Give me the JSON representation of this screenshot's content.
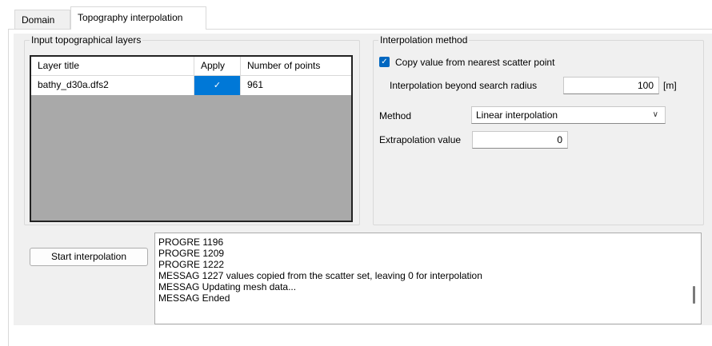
{
  "tabs": [
    {
      "label": "Domain"
    },
    {
      "label": "Topography interpolation"
    }
  ],
  "input_layers": {
    "title": "Input topographical layers",
    "columns": [
      "Layer title",
      "Apply",
      "Number of points"
    ],
    "rows": [
      {
        "layer_title": "bathy_d30a.dfs2",
        "apply": "✓",
        "number_of_points": "961"
      }
    ]
  },
  "interpolation": {
    "title": "Interpolation method",
    "copy_checkbox_label": "Copy value from nearest scatter point",
    "copy_checked": "✓",
    "beyond_radius_label": "Interpolation beyond search radius",
    "beyond_radius_value": "100",
    "beyond_radius_unit": "[m]",
    "method_label": "Method",
    "method_value": "Linear interpolation",
    "extrapolation_label": "Extrapolation value",
    "extrapolation_value": "0"
  },
  "actions": {
    "start_label": "Start interpolation"
  },
  "log": {
    "lines": [
      "PROGRE 1196",
      "PROGRE 1209",
      "PROGRE 1222",
      "MESSAG 1227 values copied from the scatter set, leaving 0 for interpolation",
      "MESSAG Updating mesh data...",
      "MESSAG Ended"
    ]
  },
  "icons": {
    "checkmark": "checkmark-icon",
    "dropdown": "chevron-down-icon"
  },
  "colors": {
    "accent": "#0078d7",
    "grid_empty": "#a9a9a9",
    "panel_bg": "#f0f0f0"
  }
}
